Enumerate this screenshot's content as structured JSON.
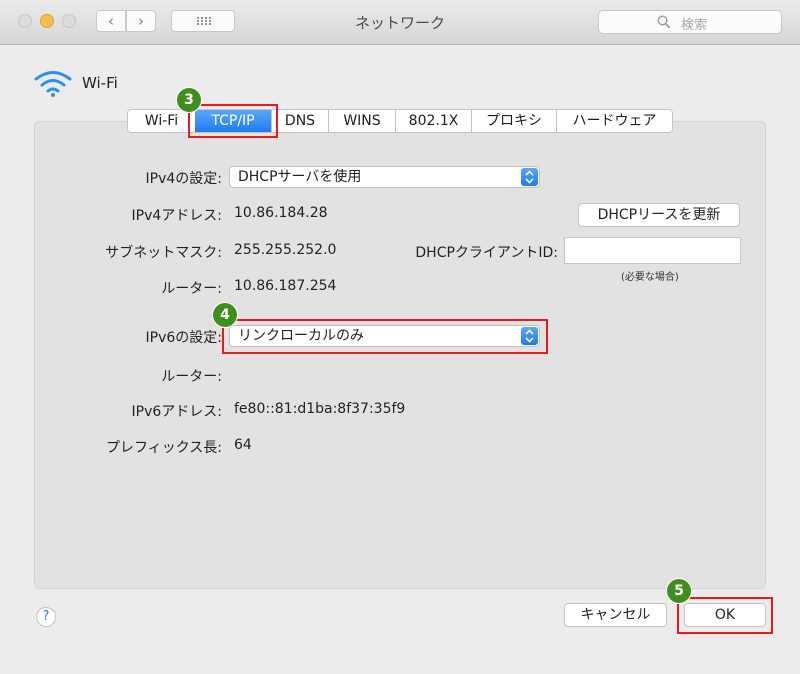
{
  "window": {
    "title": "ネットワーク"
  },
  "toolbar": {
    "back_glyph": "‹",
    "forward_glyph": "›",
    "search_placeholder": "検索"
  },
  "header": {
    "network_name": "Wi-Fi",
    "icon": "wifi-icon"
  },
  "tabs": [
    {
      "label": "Wi-Fi"
    },
    {
      "label": "TCP/IP",
      "active": true
    },
    {
      "label": "DNS"
    },
    {
      "label": "WINS"
    },
    {
      "label": "802.1X"
    },
    {
      "label": "プロキシ"
    },
    {
      "label": "ハードウェア"
    }
  ],
  "badges": {
    "tab": "3",
    "ipv6": "4",
    "ok": "5"
  },
  "ipv4": {
    "config_label": "IPv4の設定:",
    "config_value": "DHCPサーバを使用",
    "address_label": "IPv4アドレス:",
    "address_value": "10.86.184.28",
    "subnet_label": "サブネットマスク:",
    "subnet_value": "255.255.252.0",
    "router_label": "ルーター:",
    "router_value": "10.86.187.254",
    "renew_button": "DHCPリースを更新",
    "client_id_label": "DHCPクライアントID:",
    "client_id_value": "",
    "client_id_note": "(必要な場合)"
  },
  "ipv6": {
    "config_label": "IPv6の設定:",
    "config_value": "リンクローカルのみ",
    "router_label": "ルーター:",
    "router_value": "",
    "address_label": "IPv6アドレス:",
    "address_value": "fe80::81:d1ba:8f37:35f9",
    "prefix_label": "プレフィックス長:",
    "prefix_value": "64"
  },
  "footer": {
    "help": "?",
    "cancel_button": "キャンセル",
    "ok_button": "OK"
  },
  "colors": {
    "highlight": "#e21b1b",
    "badge": "#3f8f1f",
    "accent": "#1f7bf0"
  }
}
